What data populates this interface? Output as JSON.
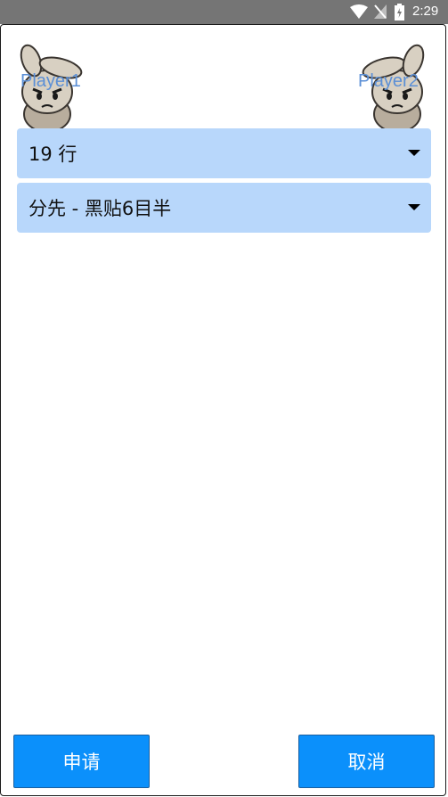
{
  "status_bar": {
    "time": "2:29",
    "icons": [
      "wifi-icon",
      "no-signal-icon",
      "battery-charging-icon"
    ]
  },
  "players": {
    "left": {
      "label": "Player1",
      "avatar": "rabbit-avatar"
    },
    "right": {
      "label": "Player2",
      "avatar": "rabbit-avatar"
    }
  },
  "settings": {
    "board_size": {
      "value": "19 行"
    },
    "handicap": {
      "value": "分先 - 黑贴6目半"
    }
  },
  "buttons": {
    "apply_label": "申请",
    "cancel_label": "取消"
  },
  "colors": {
    "accent": "#0b90fb",
    "select_bg": "#b8d7fb",
    "player_label": "#5b8fd6",
    "status_bar": "#757575"
  }
}
